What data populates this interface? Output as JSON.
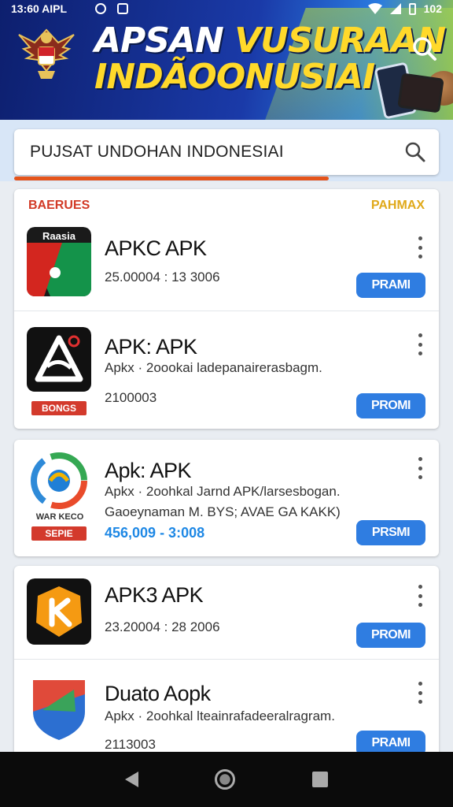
{
  "status_bar": {
    "time": "13:60 AIPL",
    "battery": "102"
  },
  "banner": {
    "title_line1_white": "APSAN ",
    "title_line1_yellow": "VUSURAAN",
    "title_line2": "INDÃOONUSIAI"
  },
  "search": {
    "placeholder": "PUJSAT UNDOHAN INDONESIAI"
  },
  "section": {
    "left": "BAERUES",
    "right": "PAHMAX"
  },
  "apps": [
    {
      "name": "APKC APK",
      "lines": [
        "25.00004 : 13 3006"
      ],
      "button": "PRAMI",
      "icon_label": "Raasia",
      "icon_colors": [
        "#0f7a3c",
        "#1b1b1b"
      ]
    },
    {
      "name": "APK: APK",
      "lines": [
        "Apkx · 2oookai ladepanairerasbagm.",
        "2100003"
      ],
      "button": "PROMI",
      "tag": "BONGS"
    },
    {
      "name": "Apk: APK",
      "lines": [
        "Apkx · 2oohkal Jarnd APK/larsesbogan.",
        "Gaoeynaman M. BYS; AVAE GA KAKK)",
        "456,009 - 3:008"
      ],
      "button": "PRSMI",
      "tag": "SEPIE",
      "small_label": "WAR KECO"
    },
    {
      "name": "APK3 APK",
      "lines": [
        "23.20004 : 28 2006"
      ],
      "button": "PROMI"
    },
    {
      "name": "Duato Aopk",
      "lines": [
        "Apkx · 2oohkal lteainrafadeeralragram.",
        "2113003"
      ],
      "button": "PRAMI"
    }
  ]
}
